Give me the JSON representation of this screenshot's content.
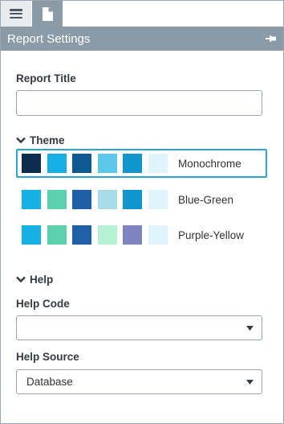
{
  "header": {
    "title": "Report Settings"
  },
  "tabs": [
    {
      "name": "menu-tab",
      "icon": "hamburger-icon"
    },
    {
      "name": "document-tab",
      "icon": "document-icon"
    }
  ],
  "report_title": {
    "label": "Report Title",
    "value": "",
    "placeholder": ""
  },
  "theme": {
    "label": "Theme",
    "options": [
      {
        "name": "Monochrome",
        "selected": true,
        "colors": [
          "#0e2c4d",
          "#14afe3",
          "#0d5a94",
          "#5cc7e8",
          "#1195cf",
          "#dff5fd"
        ]
      },
      {
        "name": "Blue-Green",
        "selected": false,
        "colors": [
          "#14afe3",
          "#5bd2ad",
          "#1e5fa8",
          "#a8dceb",
          "#1195cf",
          "#dff5fd"
        ]
      },
      {
        "name": "Purple-Yellow",
        "selected": false,
        "colors": [
          "#14afe3",
          "#5bd2ad",
          "#1e5fa8",
          "#b6f1d3",
          "#7d84c0",
          "#dff5fd"
        ]
      }
    ]
  },
  "help": {
    "label": "Help",
    "help_code": {
      "label": "Help Code",
      "value": ""
    },
    "help_source": {
      "label": "Help Source",
      "value": "Database"
    }
  },
  "colors": {
    "header_bg": "#8b9aa7",
    "accent": "#2aa6d4"
  }
}
